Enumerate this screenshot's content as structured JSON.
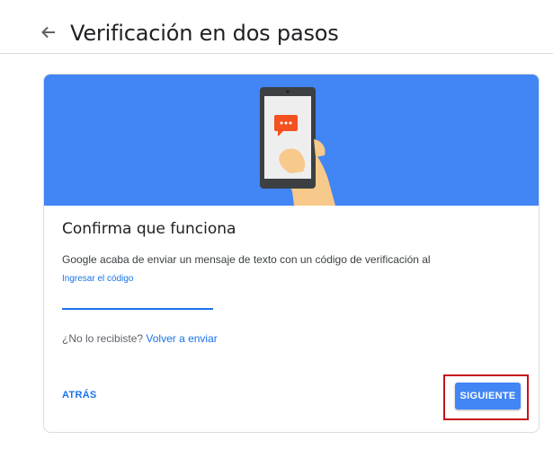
{
  "header": {
    "title": "Verificación en dos pasos",
    "back_icon": "arrow-left-icon"
  },
  "card": {
    "banner_color": "#4285f4",
    "heading": "Confirma que funciona",
    "description": "Google acaba de enviar un mensaje de texto con un código de verificación al",
    "code_label": "Ingresar el código",
    "code_value": "",
    "resend_prompt": "¿No lo recibiste?",
    "resend_link": "Volver a enviar"
  },
  "actions": {
    "back_label": "ATRÁS",
    "next_label": "SIGUIENTE",
    "accent": "#1a73e8",
    "highlight_color": "#c5141f"
  }
}
